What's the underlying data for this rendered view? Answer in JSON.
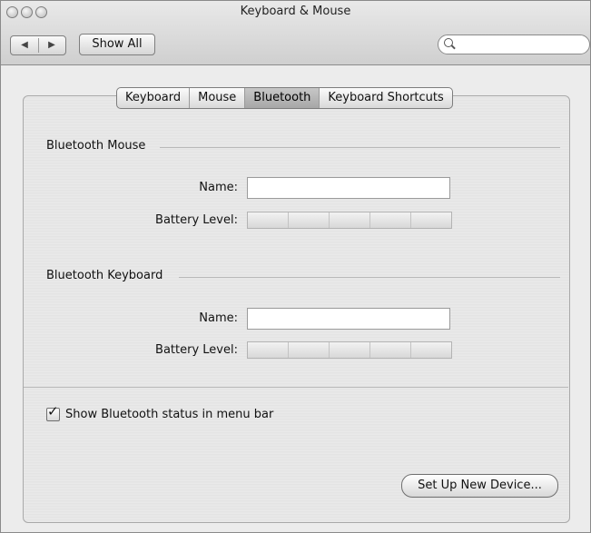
{
  "window": {
    "title": "Keyboard & Mouse"
  },
  "toolbar": {
    "back_icon": "◀",
    "forward_icon": "▶",
    "show_all_label": "Show All",
    "search_placeholder": "",
    "search_value": ""
  },
  "tabs": [
    {
      "label": "Keyboard",
      "active": false
    },
    {
      "label": "Mouse",
      "active": false
    },
    {
      "label": "Bluetooth",
      "active": true
    },
    {
      "label": "Keyboard Shortcuts",
      "active": false
    }
  ],
  "mouse_section": {
    "title": "Bluetooth Mouse",
    "name_label": "Name:",
    "name_value": "",
    "battery_label": "Battery Level:",
    "battery_level": 0
  },
  "keyboard_section": {
    "title": "Bluetooth Keyboard",
    "name_label": "Name:",
    "name_value": "",
    "battery_label": "Battery Level:",
    "battery_level": 0
  },
  "menu_bar_option": {
    "label": "Show Bluetooth status in menu bar",
    "checked": true
  },
  "setup_button": {
    "label": "Set Up New Device..."
  }
}
